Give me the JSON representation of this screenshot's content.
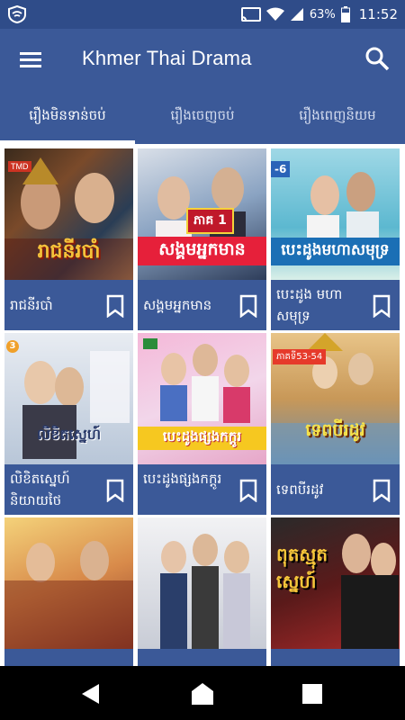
{
  "status_bar": {
    "battery": "63%",
    "time": "11:52"
  },
  "app_bar": {
    "title": "Khmer Thai Drama"
  },
  "tabs": [
    {
      "label": "រឿងមិនទាន់ចប់"
    },
    {
      "label": "រឿងចេញចប់"
    },
    {
      "label": "រឿងពេញនិយម"
    }
  ],
  "cards": [
    {
      "name": "រាជនីរបាំ",
      "thumb_title": "រាជនីរបាំ",
      "thumb_badge": "TMD"
    },
    {
      "name": "សង្គមអ្នកមាន",
      "thumb_title": "សង្គមអ្នកមាន",
      "thumb_badge": "ភាគ 1"
    },
    {
      "name": "បេះដូង មហាសមុទ្រ",
      "thumb_title": "បេះដូងមហាសមុទ្រ",
      "thumb_badge": "-6"
    },
    {
      "name": "លិខិតស្នេហ៍ និយាយថៃ",
      "thumb_title": "លិខិតស្នេហ៍",
      "thumb_badge": ""
    },
    {
      "name": "បេះដូងផ្សងកក្តូរ",
      "thumb_title": "បេះដូងផ្សងកក្តូរ",
      "thumb_badge": ""
    },
    {
      "name": "ទេពបីរដូវ",
      "thumb_title": "ទេពបីរដូវ",
      "thumb_badge": "ភាគទី53-54"
    },
    {
      "name": "",
      "thumb_title": "",
      "thumb_badge": ""
    },
    {
      "name": "",
      "thumb_title": "",
      "thumb_badge": ""
    },
    {
      "name": "",
      "thumb_title": "ពុតស្មុត ស្នេហ៍",
      "thumb_badge": ""
    }
  ]
}
